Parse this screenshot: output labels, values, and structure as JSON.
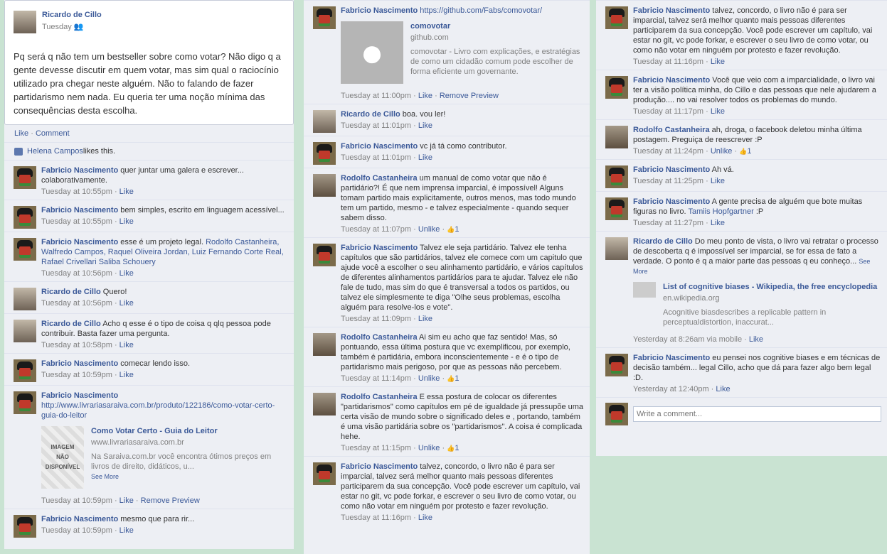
{
  "post": {
    "author": "Ricardo de Cillo",
    "time": "Tuesday",
    "text": "Pq será q não tem um bestseller sobre como votar? Não digo q a gente devesse discutir em quem votar, mas sim qual o raciocínio utilizado pra chegar neste alguém. Não to falando de fazer partidarismo nem nada. Eu queria ter uma noção mínima das consequências desta escolha.",
    "like_label": "Like",
    "comment_label": "Comment",
    "likes_name": "Helena Campos",
    "likes_suffix": " likes this."
  },
  "common": {
    "like": "Like",
    "unlike": "Unlike",
    "remove_preview": "Remove Preview",
    "see_more": "See More",
    "sep": " · "
  },
  "col1": [
    {
      "author": "Fabricio Nascimento",
      "text": " quer juntar uma galera e escrever... colaborativamente.",
      "time": "Tuesday at 10:55pm"
    },
    {
      "author": "Fabricio Nascimento",
      "text": " bem simples, escrito em linguagem acessível...",
      "time": "Tuesday at 10:55pm"
    },
    {
      "author": "Fabricio Nascimento",
      "text": " esse é um projeto legal. ",
      "tags": "Rodolfo Castanheira, Walfredo Campos, Raquel Oliveira Jordan, Luiz Fernando Corte Real, Rafael Crivellari Saliba Schouery",
      "time": "Tuesday at 10:56pm"
    },
    {
      "author": "Ricardo de Cillo",
      "text": " Quero!",
      "time": "Tuesday at 10:56pm"
    },
    {
      "author": "Ricardo de Cillo",
      "text": " Acho q esse é o tipo de coisa q qlq pessoa pode contribuir. Basta fazer uma pergunta.",
      "time": "Tuesday at 10:58pm"
    },
    {
      "author": "Fabricio Nascimento",
      "text": " comecar lendo isso.",
      "time": "Tuesday at 10:59pm"
    },
    {
      "author": "Fabricio Nascimento",
      "url": "http://www.livrariasaraiva.com.br/produto/122186/como-votar-certo-guia-do-leitor",
      "preview_title": "Como Votar Certo - Guia do Leitor",
      "preview_domain": "www.livrariasaraiva.com.br",
      "preview_desc": "Na Saraiva.com.br você encontra ótimos preços em livros de direito, didáticos, u...",
      "preview_img": "IMAGEM NÃO DISPONÍVEL",
      "time": "Tuesday at 10:59pm"
    },
    {
      "author": "Fabricio Nascimento",
      "text": " mesmo que para rir...",
      "time": "Tuesday at 10:59pm"
    }
  ],
  "col2": [
    {
      "author": "Fabricio Nascimento",
      "url": "https://github.com/Fabs/comovotar/",
      "preview_title": "comovotar",
      "preview_domain": "github.com",
      "preview_desc": "comovotar - Livro com explicações, e estratégias de como um cidadão comum pode escolher de forma eficiente um governante.",
      "time": "Tuesday at 11:00pm"
    },
    {
      "author": "Ricardo de Cillo",
      "text": " boa. vou ler!",
      "time": "Tuesday at 11:01pm"
    },
    {
      "author": "Fabricio Nascimento",
      "text": " vc já tá como contributor.",
      "time": "Tuesday at 11:01pm"
    },
    {
      "author": "Rodolfo Castanheira",
      "text": " um manual de como votar que não é partidário?! É que nem imprensa imparcial, é impossível! Alguns tomam partido mais explicitamente, outros menos, mas todo mundo tem um partido, mesmo - e talvez especialmente - quando sequer sabem disso.",
      "time": "Tuesday at 11:07pm",
      "likes": "1"
    },
    {
      "author": "Fabricio Nascimento",
      "text": " Talvez ele seja partidário. Talvez ele tenha capítulos que são partidários, talvez ele comece com um capitulo que ajude você a escolher o seu alinhamento partidário, e vários capítulos de diferentes alinhamentos partidários para te ajudar. Talvez ele não fale de tudo, mas sim do que é transversal a todos os partidos, ou talvez ele simplesmente te diga \"Olhe seus problemas, escolha alguém para resolve-los e vote\".",
      "time": "Tuesday at 11:09pm"
    },
    {
      "author": "Rodolfo Castanheira",
      "text": " Ai sim eu acho que faz sentido! Mas, só pontuando, essa última postura que vc exemplificou, por exemplo, também é partidária, embora inconscientemente - e é o tipo de partidarismo mais perigoso, por que as pessoas não percebem.",
      "time": "Tuesday at 11:14pm",
      "likes": "1"
    },
    {
      "author": "Rodolfo Castanheira",
      "text": " E essa postura de colocar os diferentes \"partidarismos\" como capítulos em pé de igualdade já pressupõe uma certa visão de mundo sobre o significado deles e , portando, também é uma visão partidária sobre os \"partidarismos\". A coisa é complicada hehe.",
      "time": "Tuesday at 11:15pm",
      "likes": "1"
    },
    {
      "author": "Fabricio Nascimento",
      "text": " talvez, concordo, o livro não é para ser imparcial, talvez será melhor quanto mais pessoas diferentes participarem da sua concepção. Você pode escrever um capítulo, vai estar no git, vc pode forkar, e escrever o seu livro de como votar, ou como não votar em ninguém por protesto e fazer revolução.",
      "time": "Tuesday at 11:16pm"
    }
  ],
  "col3": [
    {
      "author": "Fabricio Nascimento",
      "text": " talvez, concordo, o livro não é para ser imparcial, talvez será melhor quanto mais pessoas diferentes participarem da sua concepção. Você pode escrever um capítulo, vai estar no git, vc pode forkar, e escrever o seu livro de como votar, ou como não votar em ninguém por protesto e fazer revolução.",
      "time": "Tuesday at 11:16pm"
    },
    {
      "author": "Fabricio Nascimento",
      "text": " Você que veio com a imparcialidade, o livro vai ter a visão política minha, do Cillo e das pessoas que nele ajudarem a produção.... no vai resolver todos os problemas do mundo.",
      "time": "Tuesday at 11:17pm"
    },
    {
      "author": "Rodolfo Castanheira",
      "text": " ah, droga, o facebook deletou minha última postagem. Preguiça de reescrever :P",
      "time": "Tuesday at 11:24pm",
      "likes": "1"
    },
    {
      "author": "Fabricio Nascimento",
      "text": " Ah vá.",
      "time": "Tuesday at 11:25pm"
    },
    {
      "author": "Fabricio Nascimento",
      "text": " A gente precisa de alguém que bote muitas figuras no livro. ",
      "tag": "Tamiis Hopfgartner",
      "text2": " :P",
      "time": "Tuesday at 11:27pm"
    },
    {
      "author": "Ricardo de Cillo",
      "text": " Do meu ponto de vista, o livro vai retratar o processo de descoberta q é impossível ser imparcial, se for essa de fato a verdade. O ponto é q a maior parte das pessoas q eu conheço...",
      "preview_title": "List of cognitive biases - Wikipedia, the free encyclopedia",
      "preview_domain": "en.wikipedia.org",
      "preview_desc": "Acognitive biasdescribes a replicable pattern in perceptualdistortion, inaccurat...",
      "time": "Yesterday at 8:26am via mobile"
    },
    {
      "author": "Fabricio Nascimento",
      "text": " eu pensei nos cognitive biases e em técnicas de decisão também... legal Cillo, acho que dá para fazer algo bem legal :D.",
      "time": "Yesterday at 12:40pm"
    }
  ],
  "write_placeholder": "Write a comment..."
}
